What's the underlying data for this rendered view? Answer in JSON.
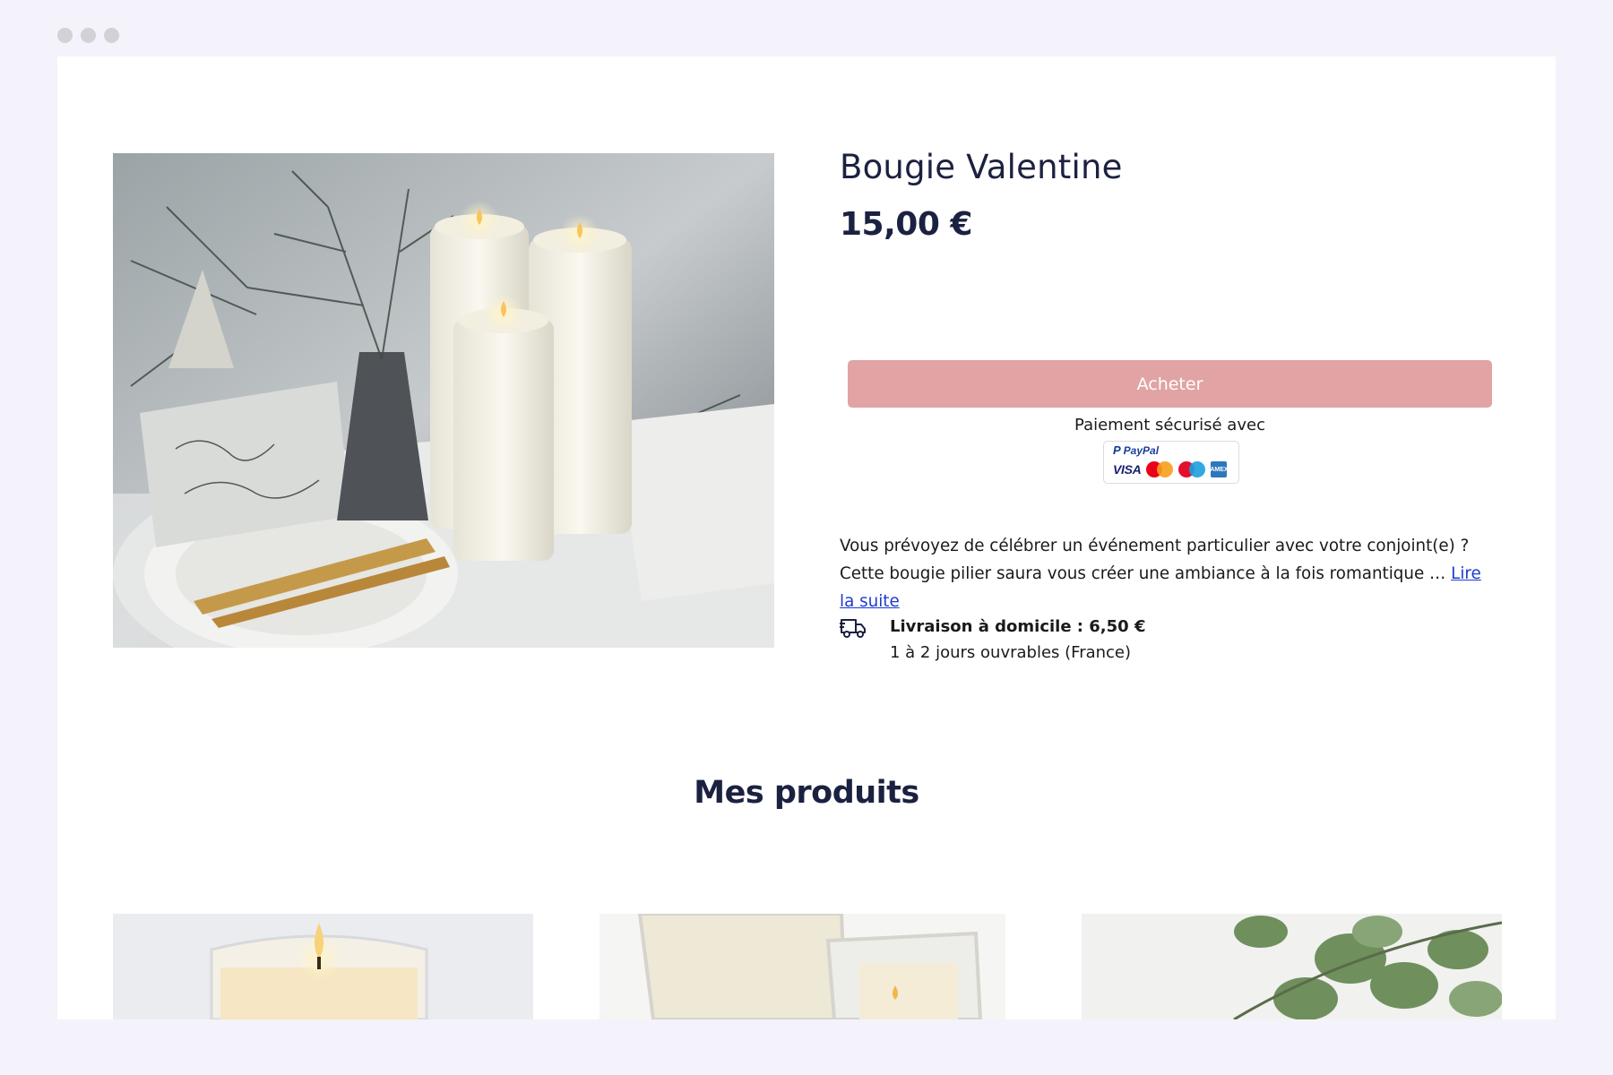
{
  "window": {
    "controls": [
      "close",
      "minimize",
      "maximize"
    ]
  },
  "product": {
    "title": "Bougie Valentine",
    "price": "15,00 €",
    "image_icon": "candles-photo",
    "buy_label": "Acheter",
    "secure_payment": "Paiement sécurisé avec",
    "payment": {
      "paypal_label": "PayPal",
      "visa_label": "VISA",
      "amex_label": "AMEX",
      "methods": [
        "paypal-icon",
        "visa-icon",
        "mastercard-icon",
        "maestro-icon",
        "amex-icon"
      ]
    },
    "description": "Vous prévoyez de célébrer un événement particulier avec votre conjoint(e) ? Cette bougie pilier saura vous créer une ambiance à la fois romantique … ",
    "read_more": "Lire la suite",
    "delivery": {
      "icon": "truck-icon",
      "title": "Livraison à domicile : 6,50 €",
      "subtitle": "1 à 2 jours ouvrables (France)"
    }
  },
  "products_section": {
    "title": "Mes produits",
    "items": [
      {
        "image_icon": "candle-jar-photo"
      },
      {
        "image_icon": "square-candles-photo"
      },
      {
        "image_icon": "eucalyptus-photo"
      }
    ]
  },
  "colors": {
    "page_bg": "#f4f3fb",
    "heading": "#1b2140",
    "buy_button": "#e1a3a3",
    "link": "#1d3bd1"
  }
}
